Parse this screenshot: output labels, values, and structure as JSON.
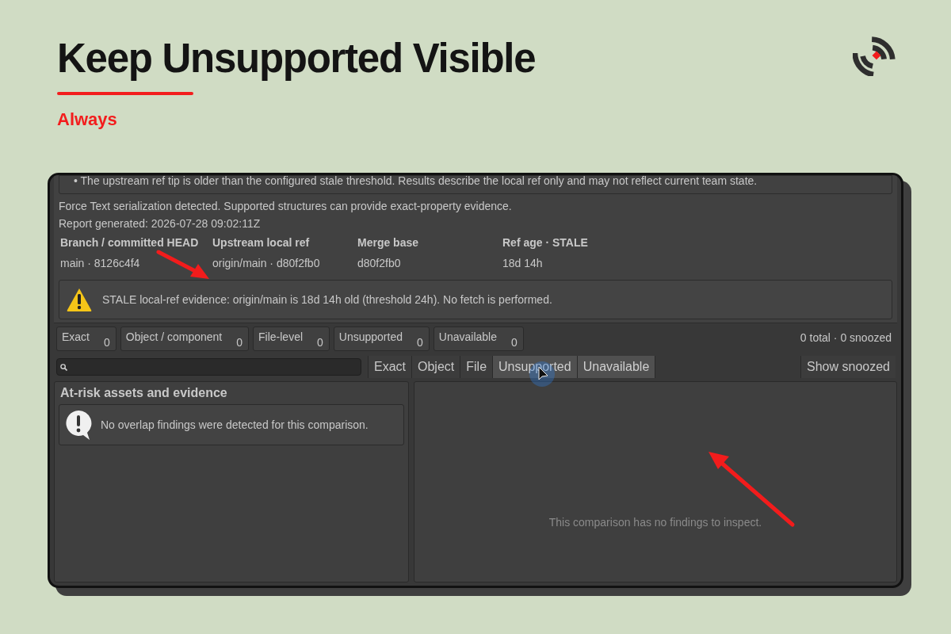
{
  "header": {
    "title": "Keep Unsupported Visible",
    "subtitle": "Always"
  },
  "report": {
    "note": "• The upstream ref tip is older than the configured stale threshold. Results describe the local ref only and may not reflect current team state.",
    "lines": [
      "Force Text serialization detected. Supported structures can provide exact-property evidence.",
      "Report generated: 2026-07-28 09:02:11Z"
    ],
    "columns": [
      {
        "heading": "Branch / committed HEAD",
        "value": "main · 8126c4f4"
      },
      {
        "heading": "Upstream local ref",
        "value": "origin/main · d80f2fb0"
      },
      {
        "heading": "Merge base",
        "value": "d80f2fb0"
      },
      {
        "heading": "Ref age · STALE",
        "value": "18d 14h"
      }
    ],
    "warning": "STALE local-ref evidence: origin/main is 18d 14h old (threshold 24h). No fetch is performed."
  },
  "counts": [
    {
      "label": "Exact",
      "count": "0"
    },
    {
      "label": "Object / component",
      "count": "0"
    },
    {
      "label": "File-level",
      "count": "0"
    },
    {
      "label": "Unsupported",
      "count": "0"
    },
    {
      "label": "Unavailable",
      "count": "0"
    }
  ],
  "summary": "0 total · 0 snoozed",
  "filters": [
    {
      "label": "Exact",
      "selected": false
    },
    {
      "label": "Object",
      "selected": false
    },
    {
      "label": "File",
      "selected": false
    },
    {
      "label": "Unsupported",
      "selected": true
    },
    {
      "label": "Unavailable",
      "selected": true
    }
  ],
  "show_snoozed": "Show snoozed",
  "left_panel": {
    "title": "At-risk assets and evidence",
    "message": "No overlap findings were detected for this comparison."
  },
  "right_panel": {
    "message": "This comparison has no findings to inspect."
  }
}
